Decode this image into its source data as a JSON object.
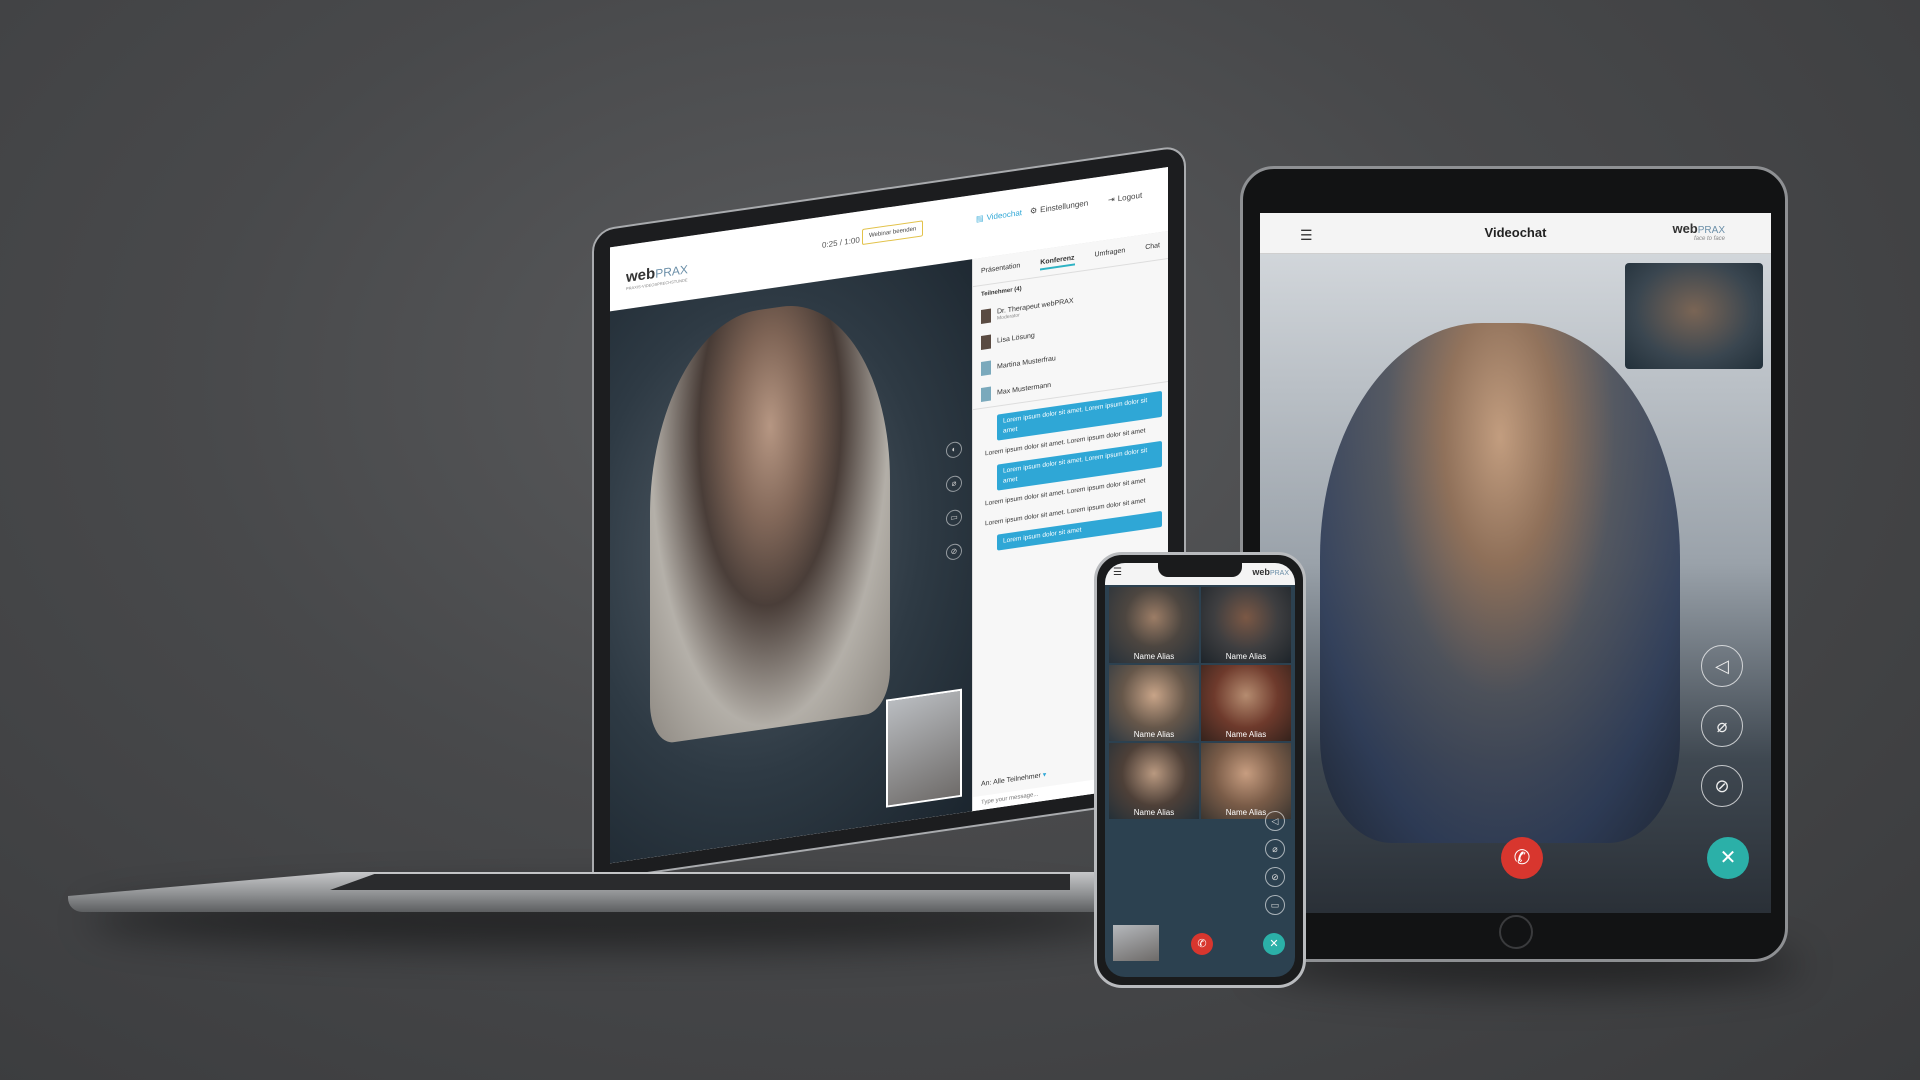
{
  "laptop": {
    "logo_main": "web",
    "logo_accent": "PRAX",
    "logo_tagline": "PRAXIS-VIDEOSPRECHSTUNDE",
    "timer": "0:25 / 1:00",
    "end_button": "Webinar beenden",
    "nav": {
      "videochat": "Videochat",
      "settings": "Einstellungen",
      "logout": "Logout"
    },
    "tabs": [
      "Präsentation",
      "Konferenz",
      "Umfragen",
      "Chat"
    ],
    "active_tab": "Konferenz",
    "participants_heading": "Teilnehmer (4)",
    "participants": [
      {
        "name": "Dr. Therapeut webPRAX",
        "role": "Moderator"
      },
      {
        "name": "Lisa Lösung",
        "role": ""
      },
      {
        "name": "Martina Musterfrau",
        "role": ""
      },
      {
        "name": "Max Mustermann",
        "role": ""
      }
    ],
    "messages": [
      {
        "from": "me",
        "text": "Lorem ipsum dolor sit amet. Lorem ipsum dolor sit amet"
      },
      {
        "from": "other",
        "text": "Lorem ipsum dolor sit amet. Lorem ipsum dolor sit amet"
      },
      {
        "from": "me",
        "text": "Lorem ipsum dolor sit amet. Lorem ipsum dolor sit amet"
      },
      {
        "from": "other",
        "text": "Lorem ipsum dolor sit amet. Lorem ipsum dolor sit amet"
      },
      {
        "from": "other",
        "text": "Lorem ipsum dolor sit amet. Lorem ipsum dolor sit amet"
      },
      {
        "from": "me",
        "text": "Lorem ipsum dolor sit amet"
      }
    ],
    "recipient_label": "An:",
    "recipient_value": "Alle Teilnehmer",
    "compose_placeholder": "Type your message..."
  },
  "tablet": {
    "title": "Videochat",
    "logo_main": "web",
    "logo_accent": "PRAX",
    "logo_tagline": "face to face"
  },
  "phone": {
    "logo_main": "web",
    "logo_accent": "PRAX",
    "tiles": [
      "Name Alias",
      "Name Alias",
      "Name Alias",
      "Name Alias",
      "Name Alias",
      "Name Alias"
    ]
  },
  "icons": {
    "menu": "hamburger-icon",
    "hangup": "phone-hangup-icon",
    "close": "close-icon",
    "mic_off": "mic-off-icon",
    "camera_off": "camera-off-icon",
    "speaker": "speaker-icon",
    "chat": "chat-icon"
  },
  "colors": {
    "accent_teal": "#2bb0a8",
    "hangup_red": "#d8362e",
    "chat_blue": "#2fa7d6",
    "background": "#48494b"
  }
}
